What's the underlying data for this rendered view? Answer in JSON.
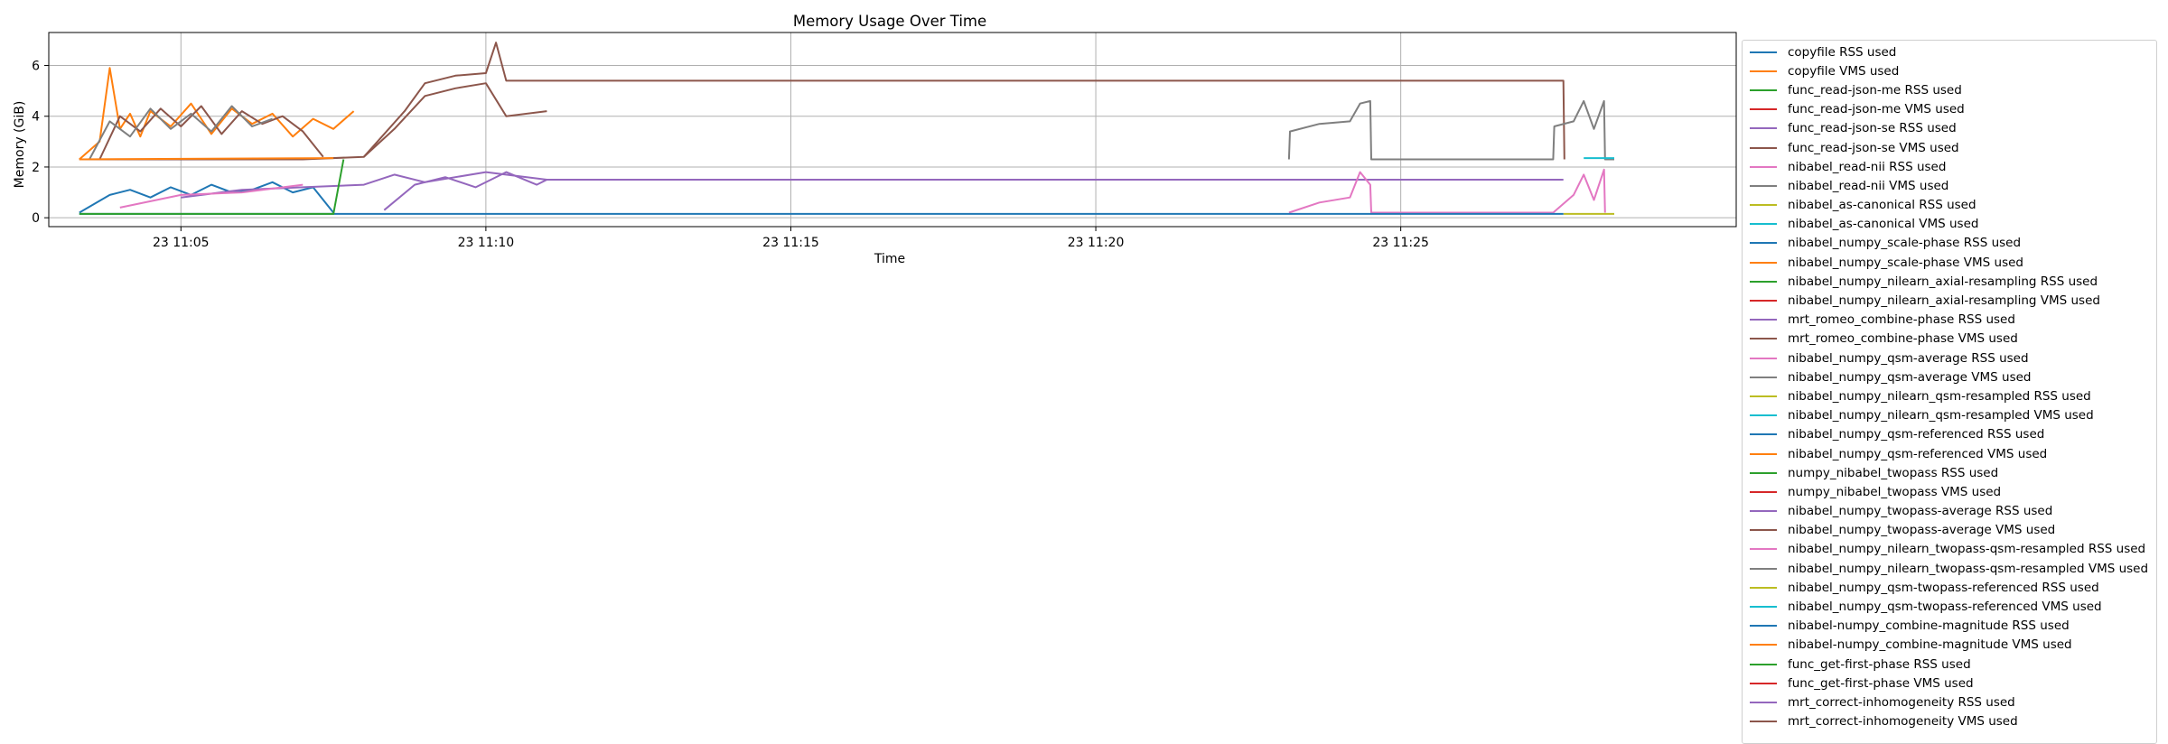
{
  "chart_data": {
    "type": "line",
    "title": "Memory Usage Over Time",
    "xlabel": "Time",
    "ylabel": "Memory (GiB)",
    "x_ticks": [
      "23 11:05",
      "23 11:10",
      "23 11:15",
      "23 11:20",
      "23 11:25"
    ],
    "y_ticks": [
      "0",
      "2",
      "4",
      "6"
    ],
    "xlim": [
      "11:02:50",
      "11:30:30"
    ],
    "ylim": [
      -0.35,
      7.3
    ],
    "grid": true,
    "legend_position": "outside-right",
    "colors": [
      "#1f77b4",
      "#ff7f0e",
      "#2ca02c",
      "#d62728",
      "#9467bd",
      "#8c564b",
      "#e377c2",
      "#7f7f7f",
      "#bcbd22",
      "#17becf"
    ],
    "series": [
      {
        "name": "copyfile RSS used",
        "color": "#1f77b4"
      },
      {
        "name": "copyfile VMS used",
        "color": "#ff7f0e"
      },
      {
        "name": "func_read-json-me RSS used",
        "color": "#2ca02c"
      },
      {
        "name": "func_read-json-me VMS used",
        "color": "#d62728"
      },
      {
        "name": "func_read-json-se RSS used",
        "color": "#9467bd"
      },
      {
        "name": "func_read-json-se VMS used",
        "color": "#8c564b",
        "x": [
          "11:03:20",
          "11:05:00",
          "11:07:00",
          "11:08:00",
          "11:08:40",
          "11:09:00",
          "11:09:30",
          "11:10:00",
          "11:10:10",
          "11:10:20",
          "11:10:40",
          "11:11:00",
          "11:27:40",
          "11:27:41"
        ],
        "y": [
          2.3,
          2.3,
          2.3,
          2.4,
          4.2,
          5.3,
          5.6,
          5.7,
          6.9,
          5.4,
          5.4,
          5.4,
          5.4,
          2.3
        ]
      },
      {
        "name": "nibabel_read-nii RSS used",
        "color": "#e377c2"
      },
      {
        "name": "nibabel_read-nii VMS used",
        "color": "#7f7f7f",
        "x": [
          "11:23:10",
          "11:23:11",
          "11:23:40",
          "11:24:10",
          "11:24:20",
          "11:24:30",
          "11:24:31",
          "11:27:30",
          "11:27:31",
          "11:27:50",
          "11:28:00",
          "11:28:10",
          "11:28:20",
          "11:28:21",
          "11:28:30"
        ],
        "y": [
          2.3,
          3.4,
          3.7,
          3.8,
          4.5,
          4.6,
          2.3,
          2.3,
          3.6,
          3.8,
          4.6,
          3.5,
          4.6,
          2.3,
          2.3
        ]
      },
      {
        "name": "nibabel_as-canonical RSS used",
        "color": "#bcbd22"
      },
      {
        "name": "nibabel_as-canonical VMS used",
        "color": "#17becf",
        "x": [
          "11:28:00",
          "11:28:30"
        ],
        "y": [
          2.35,
          2.35
        ]
      },
      {
        "name": "nibabel_numpy_scale-phase RSS used",
        "color": "#1f77b4",
        "x": [
          "11:03:20",
          "11:03:50",
          "11:04:10",
          "11:04:30",
          "11:04:50",
          "11:05:10",
          "11:05:30",
          "11:05:50",
          "11:06:10",
          "11:06:30",
          "11:06:50",
          "11:07:10",
          "11:07:30"
        ],
        "y": [
          0.2,
          0.9,
          1.1,
          0.8,
          1.2,
          0.9,
          1.3,
          1.0,
          1.1,
          1.4,
          1.0,
          1.2,
          0.2
        ]
      },
      {
        "name": "nibabel_numpy_scale-phase VMS used",
        "color": "#ff7f0e",
        "x": [
          "11:03:20",
          "11:03:40",
          "11:03:50",
          "11:04:00",
          "11:04:10",
          "11:04:20",
          "11:04:30",
          "11:04:50",
          "11:05:10",
          "11:05:30",
          "11:05:50",
          "11:06:10",
          "11:06:30",
          "11:06:50",
          "11:07:10",
          "11:07:30",
          "11:07:50"
        ],
        "y": [
          2.3,
          3.0,
          5.9,
          3.5,
          4.1,
          3.2,
          4.2,
          3.6,
          4.5,
          3.3,
          4.3,
          3.7,
          4.1,
          3.2,
          3.9,
          3.5,
          4.2
        ]
      },
      {
        "name": "nibabel_numpy_nilearn_axial-resampling RSS used",
        "color": "#2ca02c"
      },
      {
        "name": "nibabel_numpy_nilearn_axial-resampling VMS used",
        "color": "#d62728"
      },
      {
        "name": "mrt_romeo_combine-phase RSS used",
        "color": "#9467bd",
        "x": [
          "11:05:00",
          "11:06:00",
          "11:07:00",
          "11:08:00",
          "11:08:30",
          "11:09:00",
          "11:10:00",
          "11:11:00",
          "11:27:40"
        ],
        "y": [
          0.8,
          1.1,
          1.2,
          1.3,
          1.7,
          1.4,
          1.8,
          1.5,
          1.5
        ]
      },
      {
        "name": "mrt_romeo_combine-phase VMS used",
        "color": "#8c564b",
        "x": [
          "11:03:40",
          "11:04:00",
          "11:04:20",
          "11:04:40",
          "11:05:00",
          "11:05:20",
          "11:05:40",
          "11:06:00",
          "11:06:20",
          "11:06:40",
          "11:07:00",
          "11:07:20"
        ],
        "y": [
          2.3,
          4.0,
          3.4,
          4.3,
          3.6,
          4.4,
          3.3,
          4.2,
          3.7,
          4.0,
          3.4,
          2.4
        ]
      },
      {
        "name": "nibabel_numpy_qsm-average RSS used",
        "color": "#e377c2",
        "x": [
          "11:23:10",
          "11:23:40",
          "11:24:10",
          "11:24:20",
          "11:24:30",
          "11:24:31",
          "11:27:30",
          "11:27:50",
          "11:28:00",
          "11:28:10",
          "11:28:20",
          "11:28:21"
        ],
        "y": [
          0.2,
          0.6,
          0.8,
          1.8,
          1.3,
          0.2,
          0.2,
          0.9,
          1.7,
          0.7,
          1.9,
          0.2
        ]
      },
      {
        "name": "nibabel_numpy_qsm-average VMS used",
        "color": "#7f7f7f",
        "x": [
          "11:03:30",
          "11:03:50",
          "11:04:10",
          "11:04:30",
          "11:04:50",
          "11:05:10",
          "11:05:30",
          "11:05:50",
          "11:06:10",
          "11:06:30"
        ],
        "y": [
          2.3,
          3.8,
          3.2,
          4.3,
          3.5,
          4.1,
          3.4,
          4.4,
          3.6,
          3.9
        ]
      },
      {
        "name": "nibabel_numpy_nilearn_qsm-resampled RSS used",
        "color": "#bcbd22",
        "x": [
          "11:27:40",
          "11:28:30"
        ],
        "y": [
          0.15,
          0.15
        ]
      },
      {
        "name": "nibabel_numpy_nilearn_qsm-resampled VMS used",
        "color": "#17becf"
      },
      {
        "name": "nibabel_numpy_qsm-referenced RSS used",
        "color": "#1f77b4",
        "x": [
          "11:03:20",
          "11:27:40"
        ],
        "y": [
          0.15,
          0.15
        ]
      },
      {
        "name": "nibabel_numpy_qsm-referenced VMS used",
        "color": "#ff7f0e",
        "x": [
          "11:03:20",
          "11:07:30"
        ],
        "y": [
          2.3,
          2.35
        ]
      },
      {
        "name": "numpy_nibabel_twopass RSS used",
        "color": "#2ca02c"
      },
      {
        "name": "numpy_nibabel_twopass VMS used",
        "color": "#d62728"
      },
      {
        "name": "nibabel_numpy_twopass-average RSS used",
        "color": "#9467bd",
        "x": [
          "11:08:20",
          "11:08:50",
          "11:09:20",
          "11:09:50",
          "11:10:20",
          "11:10:50",
          "11:11:00"
        ],
        "y": [
          0.3,
          1.3,
          1.6,
          1.2,
          1.8,
          1.3,
          1.5
        ]
      },
      {
        "name": "nibabel_numpy_twopass-average VMS used",
        "color": "#8c564b",
        "x": [
          "11:08:00",
          "11:08:30",
          "11:09:00",
          "11:09:30",
          "11:10:00",
          "11:10:20",
          "11:11:00"
        ],
        "y": [
          2.4,
          3.5,
          4.8,
          5.1,
          5.3,
          4.0,
          4.2
        ]
      },
      {
        "name": "nibabel_numpy_nilearn_twopass-qsm-resampled RSS used",
        "color": "#e377c2",
        "x": [
          "11:04:00",
          "11:05:00",
          "11:06:00",
          "11:07:00"
        ],
        "y": [
          0.4,
          0.9,
          1.0,
          1.3
        ]
      },
      {
        "name": "nibabel_numpy_nilearn_twopass-qsm-resampled VMS used",
        "color": "#7f7f7f"
      },
      {
        "name": "nibabel_numpy_qsm-twopass-referenced RSS used",
        "color": "#bcbd22"
      },
      {
        "name": "nibabel_numpy_qsm-twopass-referenced VMS used",
        "color": "#17becf"
      },
      {
        "name": "nibabel-numpy_combine-magnitude RSS used",
        "color": "#1f77b4"
      },
      {
        "name": "nibabel-numpy_combine-magnitude VMS used",
        "color": "#ff7f0e"
      },
      {
        "name": "func_get-first-phase RSS used",
        "color": "#2ca02c",
        "x": [
          "11:03:20",
          "11:07:30",
          "11:07:40"
        ],
        "y": [
          0.15,
          0.15,
          2.3
        ]
      },
      {
        "name": "func_get-first-phase VMS used",
        "color": "#d62728"
      },
      {
        "name": "mrt_correct-inhomogeneity RSS used",
        "color": "#9467bd"
      },
      {
        "name": "mrt_correct-inhomogeneity VMS used",
        "color": "#8c564b"
      }
    ]
  }
}
